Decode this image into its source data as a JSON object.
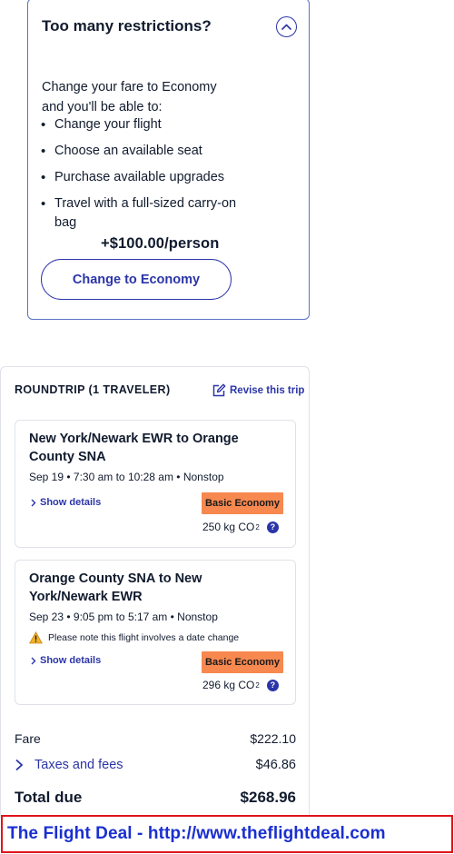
{
  "upsell": {
    "title": "Too many restrictions?",
    "intro": "Change your fare to Economy and you'll be able to:",
    "benefits": [
      "Change your flight",
      "Choose an available seat",
      "Purchase available upgrades",
      "Travel with a full-sized carry-on bag"
    ],
    "price": "+$100.00/person",
    "button_label": "Change to Economy"
  },
  "summary": {
    "heading": "ROUNDTRIP (1 TRAVELER)",
    "revise_label": "Revise this trip",
    "flights": [
      {
        "route": "New York/Newark EWR to Orange County SNA",
        "times": "Sep 19 • 7:30 am to 10:28 am • Nonstop",
        "details_label": "Show details",
        "fare_class": "Basic Economy",
        "co2_value": "250 kg CO",
        "co2_sub": "2"
      },
      {
        "route": "Orange County SNA to New York/Newark EWR",
        "times": "Sep 23 • 9:05 pm to 5:17 am • Nonstop",
        "notice": "Please note this flight involves a date change",
        "details_label": "Show details",
        "fare_class": "Basic Economy",
        "co2_value": "296 kg CO",
        "co2_sub": "2"
      }
    ],
    "fare_label": "Fare",
    "fare_value": "$222.10",
    "taxes_label": "Taxes and fees",
    "taxes_value": "$46.86",
    "total_label": "Total due",
    "total_value": "$268.96"
  },
  "watermark": "The Flight Deal - http://www.theflightdeal.com",
  "colors": {
    "accent": "#2b35a8",
    "badge": "#f7884f",
    "watermark_text": "#1a2fd1",
    "watermark_border": "#e0141b"
  }
}
